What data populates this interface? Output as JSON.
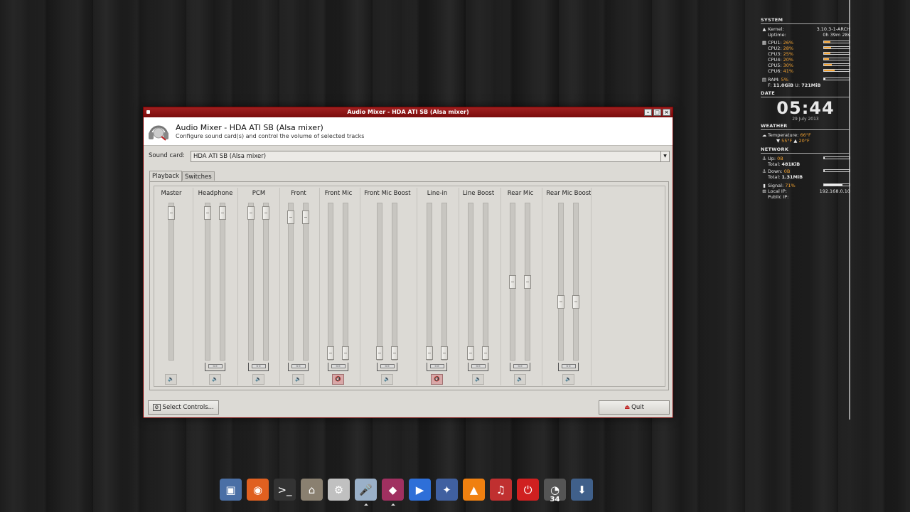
{
  "window": {
    "title": "Audio Mixer - HDA ATI SB (Alsa mixer)",
    "header_title": "Audio Mixer - HDA ATI SB (Alsa mixer)",
    "header_subtitle": "Configure sound card(s) and control the volume of selected tracks"
  },
  "soundcard": {
    "label": "Sound card:",
    "value": "HDA ATI SB (Alsa mixer)"
  },
  "tabs": [
    {
      "label": "Playback",
      "active": true
    },
    {
      "label": "Switches",
      "active": false
    }
  ],
  "channels": [
    {
      "label": "Master",
      "levels": [
        0.98
      ],
      "muted": false
    },
    {
      "label": "Headphone",
      "levels": [
        0.98,
        0.98
      ],
      "muted": false
    },
    {
      "label": "PCM",
      "levels": [
        0.98,
        0.98
      ],
      "muted": false
    },
    {
      "label": "Front",
      "levels": [
        0.95,
        0.95
      ],
      "muted": false
    },
    {
      "label": "Front Mic",
      "levels": [
        0.0,
        0.0
      ],
      "muted": true
    },
    {
      "label": "Front Mic Boost",
      "levels": [
        0.0,
        0.0
      ],
      "muted": false
    },
    {
      "label": "Line-in",
      "levels": [
        0.0,
        0.0
      ],
      "muted": true
    },
    {
      "label": "Line Boost",
      "levels": [
        0.0,
        0.0
      ],
      "muted": false
    },
    {
      "label": "Rear Mic",
      "levels": [
        0.5,
        0.5
      ],
      "muted": false
    },
    {
      "label": "Rear Mic Boost",
      "levels": [
        0.36,
        0.36
      ],
      "muted": false
    }
  ],
  "buttons": {
    "select_controls": "Select Controls...",
    "quit": "Quit"
  },
  "conky": {
    "system_header": "SYSTEM",
    "kernel_label": "Kernel:",
    "kernel_value": "3.10.3-1-ARCH",
    "uptime_label": "Uptime:",
    "uptime_value": "0h 39m 28s",
    "cpus": [
      {
        "label": "CPU1:",
        "value": "26%",
        "usage": 0.26
      },
      {
        "label": "CPU2:",
        "value": "28%",
        "usage": 0.28
      },
      {
        "label": "CPU3:",
        "value": "25%",
        "usage": 0.25
      },
      {
        "label": "CPU4:",
        "value": "20%",
        "usage": 0.2
      },
      {
        "label": "CPU5:",
        "value": "30%",
        "usage": 0.3
      },
      {
        "label": "CPU6:",
        "value": "41%",
        "usage": 0.41
      }
    ],
    "ram_label": "RAM:",
    "ram_value": "5%",
    "mem_free_label": "F:",
    "mem_free": "11.0GiB",
    "mem_used_label": "U:",
    "mem_used": "721MiB",
    "date_header": "DATE",
    "time": "05:44",
    "date": "29 July 2013",
    "weather_header": "WEATHER",
    "temperature_label": "Temperature:",
    "temperature": "66°F",
    "temp_low": "55°F",
    "temp_high": "20°F",
    "network_header": "NETWORK",
    "up_label": "Up:",
    "up_value": "0B",
    "up_total_label": "Total:",
    "up_total": "481KiB",
    "down_label": "Down:",
    "down_value": "0B",
    "down_total_label": "Total:",
    "down_total": "1.31MiB",
    "signal_label": "Signal:",
    "signal_value": "71%",
    "local_ip_label": "Local IP:",
    "local_ip": "192.168.0.10",
    "public_ip_label": "Public IP:"
  },
  "dock": [
    {
      "name": "installer-icon",
      "glyph": "▣",
      "color": "#4a6fa5"
    },
    {
      "name": "firefox-icon",
      "glyph": "◉",
      "color": "#e06020"
    },
    {
      "name": "terminal-icon",
      "glyph": ">_",
      "color": "#333333"
    },
    {
      "name": "home-folder-icon",
      "glyph": "⌂",
      "color": "#8a8070"
    },
    {
      "name": "disk-utility-icon",
      "glyph": "⚙",
      "color": "#c0c0c0"
    },
    {
      "name": "audio-mixer-icon",
      "glyph": "🎤",
      "color": "#9ab0c8"
    },
    {
      "name": "shapes-icon",
      "glyph": "◆",
      "color": "#a03060"
    },
    {
      "name": "media-player-icon",
      "glyph": "▶",
      "color": "#2e6fd8"
    },
    {
      "name": "satellite-icon",
      "glyph": "✦",
      "color": "#4060a0"
    },
    {
      "name": "vlc-icon",
      "glyph": "▲",
      "color": "#f08010"
    },
    {
      "name": "audio-app-icon",
      "glyph": "♫",
      "color": "#c03030"
    },
    {
      "name": "power-icon",
      "glyph": "⏻",
      "color": "#d02020"
    },
    {
      "name": "speedometer-icon",
      "glyph": "◔",
      "color": "#555555",
      "badge": "34"
    },
    {
      "name": "downloads-icon",
      "glyph": "⬇",
      "color": "#40608a"
    }
  ]
}
